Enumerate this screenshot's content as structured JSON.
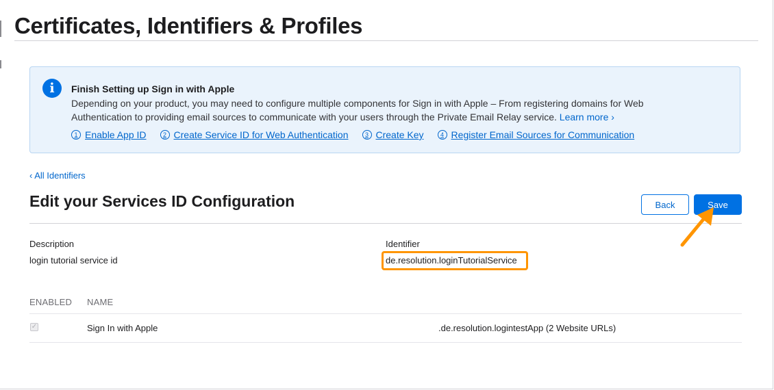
{
  "page": {
    "title": "Certificates, Identifiers & Profiles"
  },
  "banner": {
    "icon": "info-icon",
    "icon_glyph": "i",
    "heading": "Finish Setting up Sign in with Apple",
    "body": "Depending on your product, you may need to configure multiple components for Sign in with Apple – From registering domains for Web Authentication to providing email sources to communicate with your users through the Private Email Relay service.",
    "learn_more": "Learn more ›",
    "steps": [
      {
        "num": "1",
        "label": "Enable App ID"
      },
      {
        "num": "2",
        "label": "Create Service ID for Web Authentication"
      },
      {
        "num": "3",
        "label": "Create Key"
      },
      {
        "num": "4",
        "label": "Register Email Sources for Communication"
      }
    ],
    "accent_color": "#0071e3",
    "background_color": "#eaf3fc"
  },
  "nav": {
    "back_link": "‹ All Identifiers"
  },
  "section": {
    "title": "Edit your Services ID Configuration"
  },
  "buttons": {
    "back": "Back",
    "save": "Save"
  },
  "fields": {
    "description_label": "Description",
    "description_value": "login tutorial service id",
    "identifier_label": "Identifier",
    "identifier_value": "de.resolution.loginTutorialService"
  },
  "table": {
    "headers": {
      "enabled": "ENABLED",
      "name": "NAME"
    },
    "rows": [
      {
        "enabled": true,
        "name": "Sign In with Apple",
        "detail": ".de.resolution.logintestApp (2 Website URLs)"
      }
    ]
  },
  "annotation": {
    "highlight_color": "#ff9500",
    "arrow_icon": "arrow-up-right-icon"
  }
}
